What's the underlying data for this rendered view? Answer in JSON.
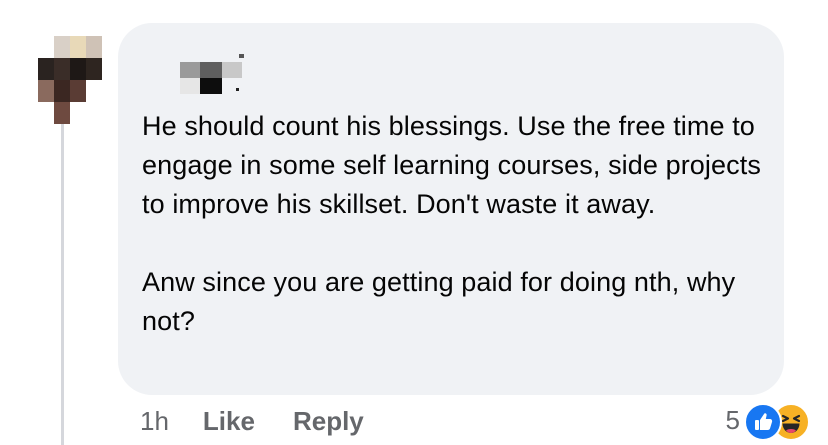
{
  "comment": {
    "author_name": "",
    "paragraphs": [
      "He should count his blessings. Use the free time to engage in some self learning courses, side projects to improve his skillset. Don't waste it away.",
      "Anw since you are getting paid for doing nth, why not?"
    ],
    "timestamp": "1h",
    "like_label": "Like",
    "reply_label": "Reply",
    "reaction_count": "5",
    "reactions": [
      "like-icon",
      "haha-icon"
    ]
  },
  "colors": {
    "bubble_background": "#f0f2f5",
    "text": "#050505",
    "secondary_text": "#65676b",
    "like_blue": "#1877f2",
    "haha_yellow": "#f7b125"
  }
}
